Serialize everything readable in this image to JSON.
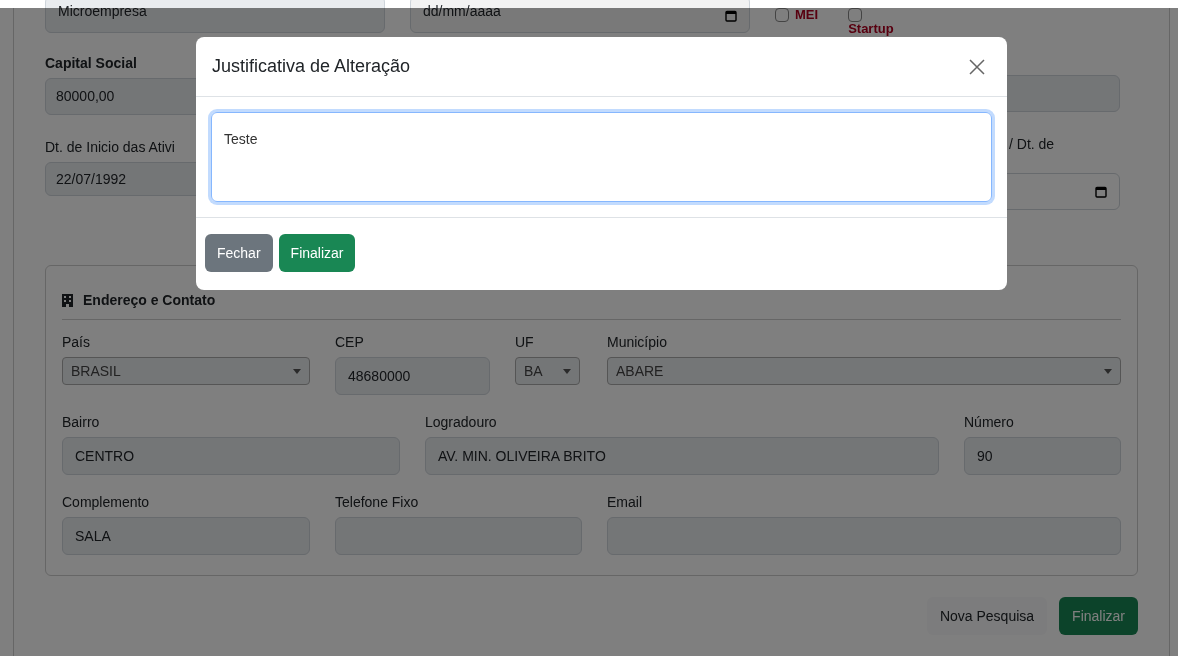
{
  "page": {
    "top_row": {
      "company_size": "Microempresa",
      "date_placeholder": "dd/mm/aaaa",
      "checkboxes": [
        {
          "label": "MEI",
          "checked": false
        },
        {
          "label": "Startup",
          "checked": false
        }
      ]
    },
    "capital_social": {
      "label": "Capital Social",
      "value": "80000,00"
    },
    "start_date": {
      "label": "Dt. de Inicio das Ativi",
      "value": "22/07/1992"
    },
    "right_date_label": "/ Dt. de",
    "address": {
      "title": "Endereço e Contato",
      "fields": [
        {
          "label": "País",
          "kind": "select",
          "value": "BRASIL"
        },
        {
          "label": "CEP",
          "kind": "input",
          "value": "48680000"
        },
        {
          "label": "UF",
          "kind": "select",
          "value": "BA"
        },
        {
          "label": "Município",
          "kind": "select",
          "value": "ABARE"
        },
        {
          "label": "Bairro",
          "kind": "input",
          "value": "CENTRO"
        },
        {
          "label": "Logradouro",
          "kind": "input",
          "value": "AV. MIN. OLIVEIRA BRITO"
        },
        {
          "label": "Número",
          "kind": "input",
          "value": "90"
        },
        {
          "label": "Complemento",
          "kind": "input",
          "value": "SALA"
        },
        {
          "label": "Telefone Fixo",
          "kind": "input"
        },
        {
          "label": "Email",
          "kind": "input"
        }
      ]
    },
    "buttons": [
      {
        "label": "Nova Pesquisa",
        "kind": "light"
      },
      {
        "label": "Finalizar",
        "kind": "success"
      }
    ]
  },
  "modal": {
    "title": "Justificativa de Alteração",
    "justification": "Teste",
    "buttons": [
      {
        "label": "Fechar",
        "kind": "secondary"
      },
      {
        "label": "Finalizar",
        "kind": "success"
      }
    ]
  }
}
